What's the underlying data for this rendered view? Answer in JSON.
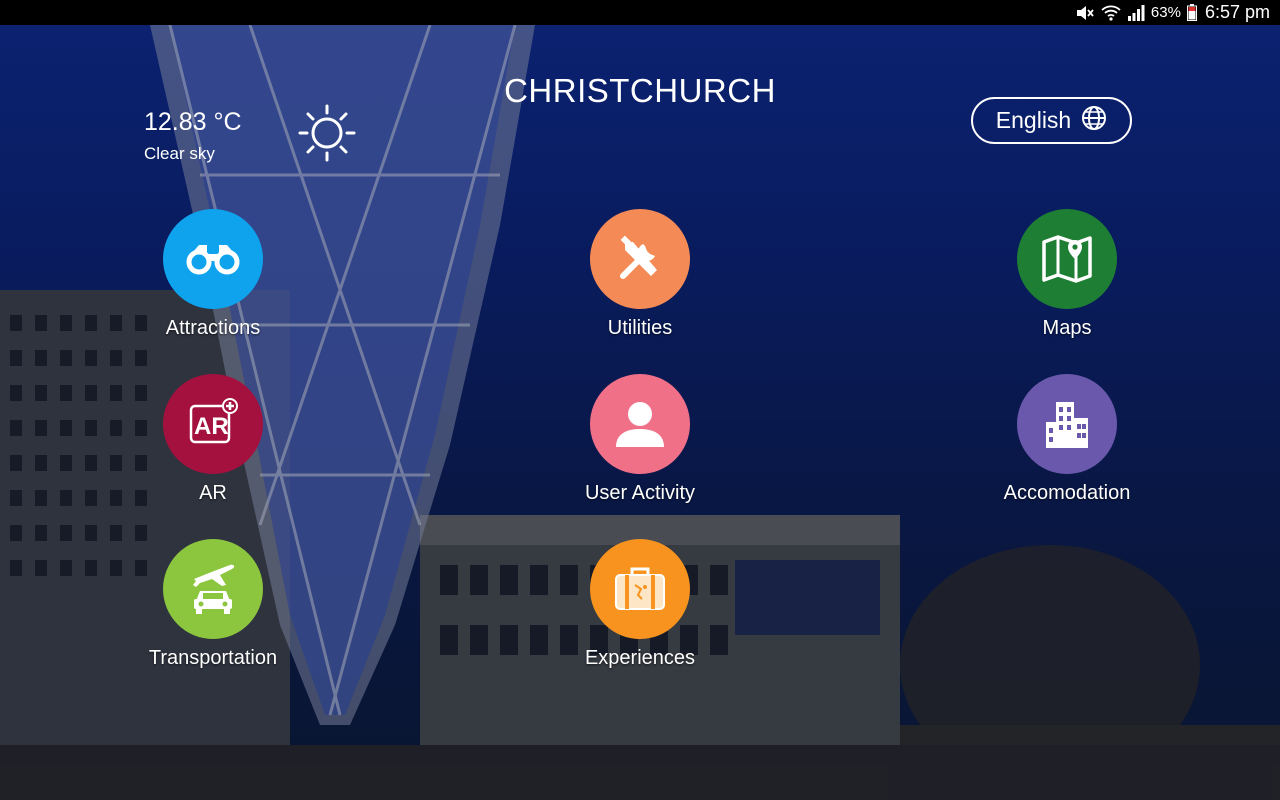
{
  "status_bar": {
    "battery_percent": "63%",
    "time": "6:57 pm"
  },
  "header": {
    "city": "CHRISTCHURCH",
    "temperature": "12.83 °C",
    "condition": "Clear sky",
    "weather_icon": "sun-icon",
    "language_label": "English"
  },
  "tiles": [
    {
      "label": "Attractions",
      "icon": "binoculars-icon",
      "color": "#0fa3ee"
    },
    {
      "label": "Utilities",
      "icon": "tools-icon",
      "color": "#f48a56"
    },
    {
      "label": "Maps",
      "icon": "map-icon",
      "color": "#1e7e34"
    },
    {
      "label": "AR",
      "icon": "ar-icon",
      "color": "#a5113e"
    },
    {
      "label": "User Activity",
      "icon": "user-icon",
      "color": "#f07088"
    },
    {
      "label": "Accomodation",
      "icon": "building-icon",
      "color": "#6a58ad"
    },
    {
      "label": "Transportation",
      "icon": "transport-icon",
      "color": "#8cc63f"
    },
    {
      "label": "Experiences",
      "icon": "suitcase-icon",
      "color": "#f7931e"
    }
  ]
}
